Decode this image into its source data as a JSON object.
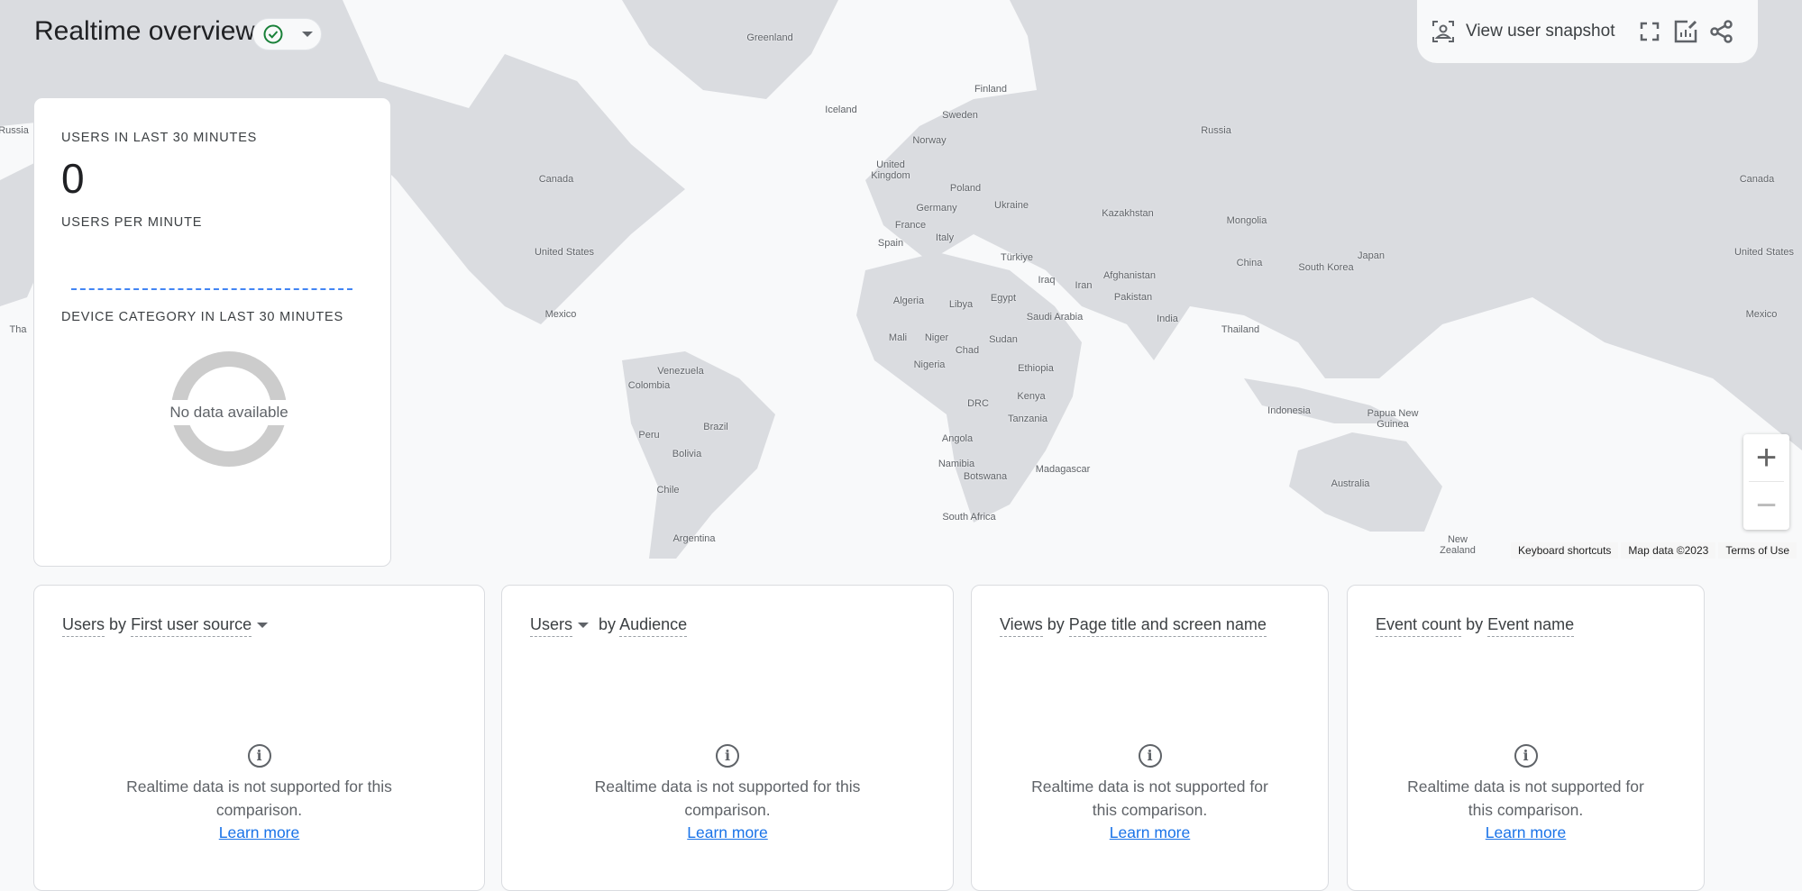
{
  "header": {
    "title": "Realtime overview",
    "status_icon": "check-circle-icon",
    "status_color": "#188038"
  },
  "toolbar": {
    "snapshot_label": "View user snapshot",
    "icons": [
      "user-snapshot-icon",
      "fullscreen-icon",
      "customize-report-icon",
      "share-icon"
    ]
  },
  "summary": {
    "users_label": "USERS IN LAST 30 MINUTES",
    "users_value": "0",
    "per_minute_label": "USERS PER MINUTE",
    "device_label": "DEVICE CATEGORY IN LAST 30 MINUTES",
    "device_empty": "No data available"
  },
  "map": {
    "labels": [
      "Greenland",
      "Iceland",
      "Finland",
      "Sweden",
      "Norway",
      "Russia",
      "United Kingdom",
      "Poland",
      "Germany",
      "Ukraine",
      "France",
      "Italy",
      "Spain",
      "Kazakhstan",
      "Mongolia",
      "Türkiye",
      "China",
      "South Korea",
      "Japan",
      "Afghanistan",
      "Iraq",
      "Iran",
      "Pakistan",
      "Algeria",
      "Libya",
      "Egypt",
      "Saudi Arabia",
      "India",
      "Thailand",
      "Mali",
      "Niger",
      "Chad",
      "Sudan",
      "Nigeria",
      "Ethiopia",
      "Kenya",
      "DRC",
      "Tanzania",
      "Indonesia",
      "Papua New Guinea",
      "Angola",
      "Namibia",
      "Botswana",
      "Madagascar",
      "South Africa",
      "Australia",
      "New Zealand",
      "Canada",
      "United States",
      "Mexico",
      "Venezuela",
      "Colombia",
      "Brazil",
      "Peru",
      "Bolivia",
      "Chile",
      "Argentina",
      "Russia",
      "Tha",
      "Canada",
      "United States",
      "Mexico"
    ],
    "zoom_in": "+",
    "zoom_out": "−",
    "attribution": [
      "Keyboard shortcuts",
      "Map data ©2023",
      "Terms of Use"
    ]
  },
  "cards": [
    {
      "metric": "Users",
      "by": "by",
      "dimension": "First user source",
      "metric_dropdown": false,
      "dim_dropdown": true,
      "message": "Realtime data is not supported for this comparison.",
      "link": "Learn more"
    },
    {
      "metric": "Users",
      "by": "by",
      "dimension": "Audience",
      "metric_dropdown": true,
      "dim_dropdown": false,
      "message": "Realtime data is not supported for this comparison.",
      "link": "Learn more"
    },
    {
      "metric": "Views",
      "by": "by",
      "dimension": "Page title and screen name",
      "metric_dropdown": false,
      "dim_dropdown": false,
      "message": "Realtime data is not supported for this comparison.",
      "link": "Learn more"
    },
    {
      "metric": "Event count",
      "by": "by",
      "dimension": "Event name",
      "metric_dropdown": false,
      "dim_dropdown": false,
      "message": "Realtime data is not supported for this comparison.",
      "link": "Learn more"
    }
  ],
  "colors": {
    "land": "#dadce0",
    "background": "#f8f9fa",
    "accent": "#1a73e8",
    "sparkline": "#4285f4"
  }
}
